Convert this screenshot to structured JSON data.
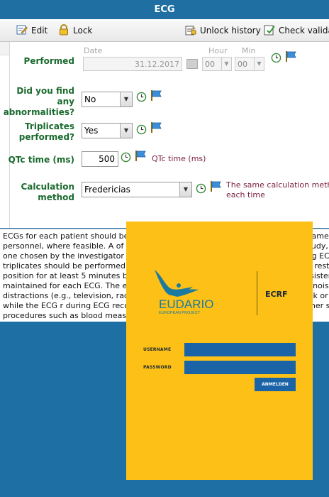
{
  "window": {
    "title": "ECG"
  },
  "toolbar": {
    "edit_label": "Edit",
    "lock_label": "Lock",
    "unlock_history_label": "Unlock history",
    "check_validation_label": "Check validati"
  },
  "form": {
    "performed": {
      "label": "Performed",
      "date_caption": "Date",
      "date_value": "31.12.2017",
      "hour_caption": "Hour",
      "hour_value": "00",
      "min_caption": "Min",
      "min_value": "00"
    },
    "abnormalities": {
      "label_l1": "Did you find",
      "label_l2": "any",
      "label_l3": "abnormalities?",
      "value": "No"
    },
    "triplicates": {
      "label_l1": "Triplicates",
      "label_l2": "performed?",
      "value": "Yes"
    },
    "qtc": {
      "label": "QTc time (ms)",
      "value": "500",
      "unit": "QTc time (ms)"
    },
    "calculation": {
      "label_l1": "Calculation",
      "label_l2": "method",
      "value": "Fredericias",
      "note_l1": "The same calculation metho",
      "note_l2": "each time"
    }
  },
  "info": {
    "text": "ECGs for each patient should be obtained using the same method and by the same personnel, where feasible. A of QTc calculation must be used throughout the study, and the one chosen by the investigator should be Fredericia preferred. For the screening ECG, triplicates should be performed and repeated if necessary. Patient must be in a resting position for at least 5 minutes before the ECG is recorded and the position consistently maintained for each ECG. The environment should be quiet with no distracting noise or enviro distractions (e.g., television, radio, conversation) and the patient should not talk or move while the ECG r during ECG recording. ECGs should be recorded prior to any other study procedures such as blood meas draws."
  },
  "login": {
    "brand": "EUDARIO",
    "brand_sub": "EUROPEAN PROJECT",
    "app_name": "ECRF",
    "username_label": "USERNAME",
    "password_label": "PASSWORD",
    "submit_label": "ANMELDEN",
    "colors": {
      "background": "#fcc016",
      "field": "#1a63a7",
      "brand_teal": "#1b7aa0"
    }
  },
  "colors": {
    "title_bar": "#1f6fa3",
    "label_green": "#1a6a2e",
    "note_maroon": "#7a1f3d"
  }
}
